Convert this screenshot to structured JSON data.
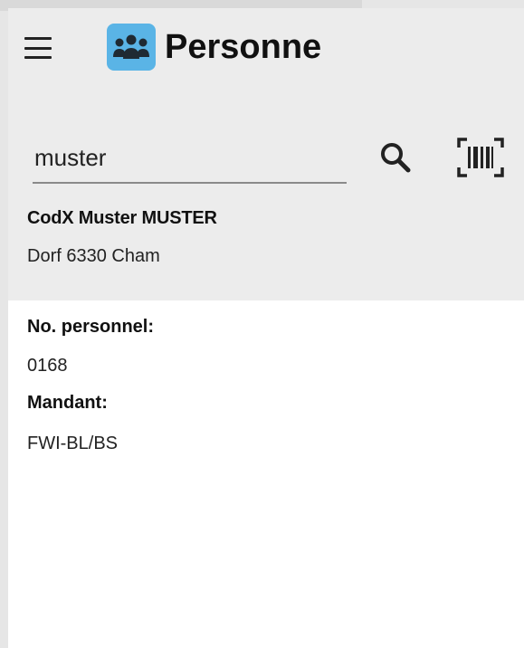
{
  "header": {
    "title": "Personne",
    "menu_icon": "hamburger-menu-icon",
    "app_icon": "people-group-icon",
    "app_icon_color": "#5ab4e6"
  },
  "search": {
    "value": "muster",
    "placeholder": "",
    "search_icon": "search-icon",
    "barcode_icon": "barcode-scan-icon"
  },
  "result": {
    "name": "CodX Muster MUSTER",
    "address": "Dorf 6330 Cham"
  },
  "details": {
    "personnel_label": "No. personnel:",
    "personnel_value": "0168",
    "mandant_label": "Mandant:",
    "mandant_value": "FWI-BL/BS"
  },
  "colors": {
    "header_background": "#ececec",
    "content_background": "#ffffff"
  }
}
